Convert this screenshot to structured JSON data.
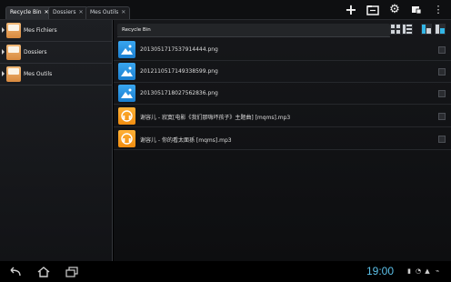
{
  "tabs": [
    {
      "label": "Recycle Bin",
      "active": true
    },
    {
      "label": "Dossiers",
      "active": false
    },
    {
      "label": "Mes Outils",
      "active": false
    }
  ],
  "toolbar": {
    "icons": [
      "add-icon",
      "new-folder-icon",
      "settings-icon",
      "cut-icon",
      "overflow-menu-icon"
    ]
  },
  "sidebar": {
    "items": [
      {
        "label": "Mes Fichiers"
      },
      {
        "label": "Dossiers"
      },
      {
        "label": "Mes Outils"
      }
    ]
  },
  "main": {
    "path": "Recycle Bin",
    "files": [
      {
        "name": "20130517175379144​44.png",
        "type": "image"
      },
      {
        "name": "20121105171493385​99.png",
        "type": "image"
      },
      {
        "name": "20130517180275628​36.png",
        "type": "image"
      },
      {
        "name": "谢容儿 - 寂寞[电影《我们那嗨坏孩子》主题曲] [mqms].mp3",
        "type": "audio"
      },
      {
        "name": "谢容儿 - 你的看太面孫 [mqms].mp3",
        "type": "audio"
      }
    ]
  },
  "statusbar": {
    "time": "19:00"
  },
  "colors": {
    "accent": "#33b5e5",
    "folder": "#e59a4c",
    "image_thumb": "#2892e3",
    "audio_thumb": "#f89d1f"
  }
}
